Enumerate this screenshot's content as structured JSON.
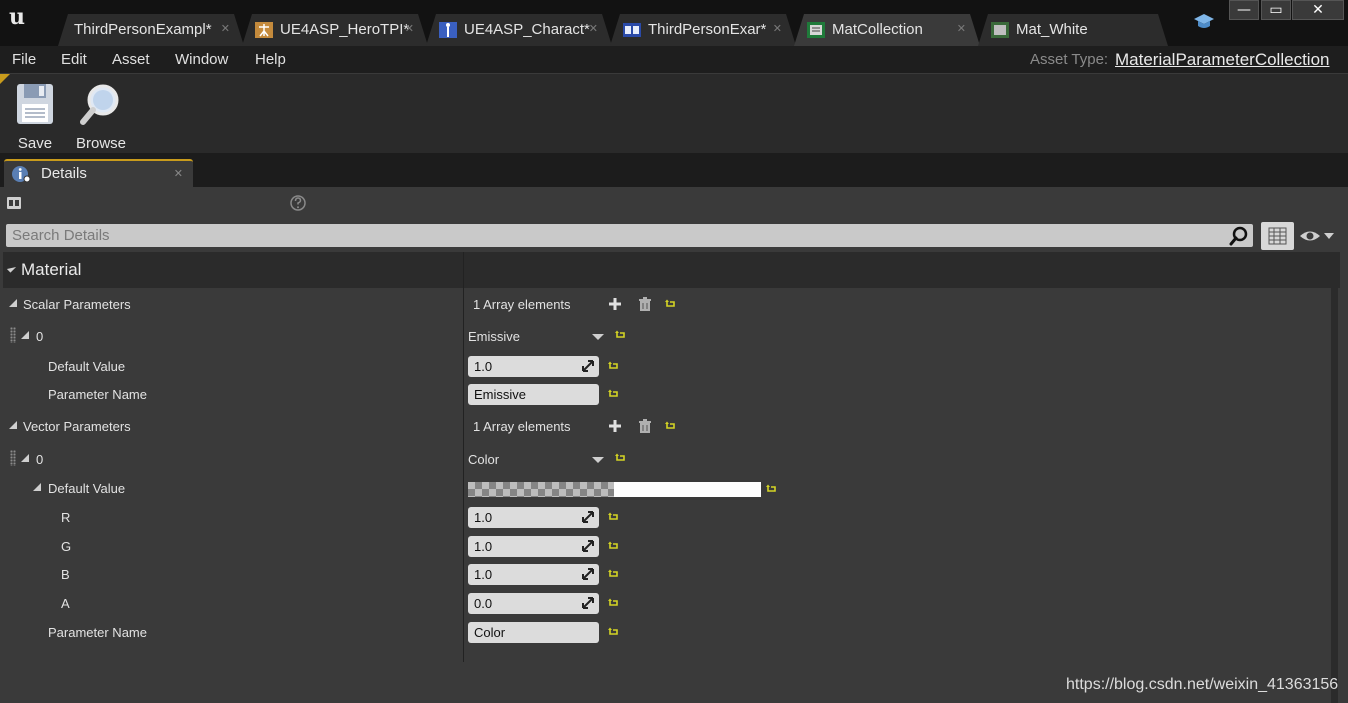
{
  "tabs": [
    {
      "label": "ThirdPersonExampl*",
      "icon": "level-icon",
      "active": false
    },
    {
      "label": "UE4ASP_HeroTPI*",
      "icon": "physics-asset-icon",
      "active": false
    },
    {
      "label": "UE4ASP_Charact*",
      "icon": "skeleton-icon",
      "active": false
    },
    {
      "label": "ThirdPersonExar*",
      "icon": "blueprint-icon",
      "active": false
    },
    {
      "label": "MatCollection",
      "icon": "material-collection-icon",
      "active": true
    },
    {
      "label": "Mat_White",
      "icon": "material-icon",
      "active": false
    }
  ],
  "window_controls": {
    "minimize": "—",
    "maximize": "▭",
    "close": "✕"
  },
  "menu": {
    "items": [
      "File",
      "Edit",
      "Asset",
      "Window",
      "Help"
    ],
    "asset_type_label": "Asset Type:",
    "asset_type_value": "MaterialParameterCollection"
  },
  "toolbar": {
    "save_label": "Save",
    "browse_label": "Browse"
  },
  "details": {
    "tab_label": "Details",
    "search_placeholder": "Search Details",
    "category": "Material",
    "scalar": {
      "label": "Scalar Parameters",
      "count_text": "1 Array elements",
      "element_index": "0",
      "element_name": "Emissive",
      "default_value_label": "Default Value",
      "default_value": "1.0",
      "param_name_label": "Parameter Name",
      "param_name": "Emissive"
    },
    "vector": {
      "label": "Vector Parameters",
      "count_text": "1 Array elements",
      "element_index": "0",
      "element_name": "Color",
      "default_value_label": "Default Value",
      "r_label": "R",
      "r": "1.0",
      "g_label": "G",
      "g": "1.0",
      "b_label": "B",
      "b": "1.0",
      "a_label": "A",
      "a": "0.0",
      "param_name_label": "Parameter Name",
      "param_name": "Color",
      "swatch_color": "#ffffff"
    }
  },
  "watermark": "https://blog.csdn.net/weixin_41363156",
  "colors": {
    "accent": "#c89b1c",
    "reset_arrow": "#d4d424",
    "panel_bg": "#3a3a3a"
  }
}
